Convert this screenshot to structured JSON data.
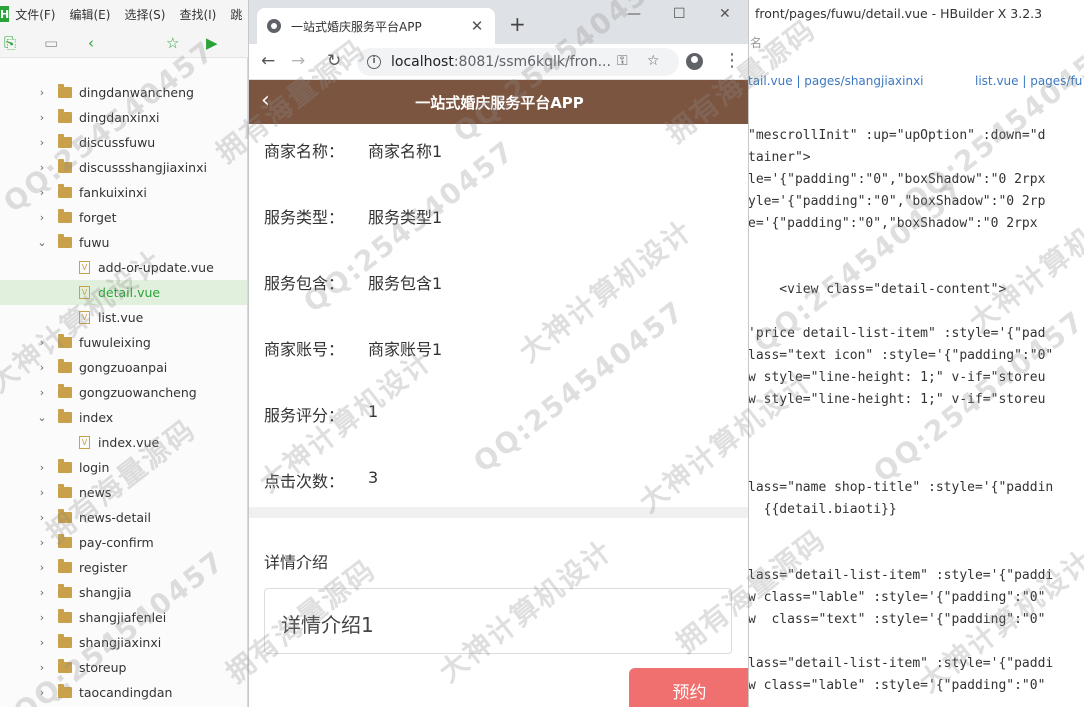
{
  "ide": {
    "logo": "H",
    "menu": [
      "文件(F)",
      "编辑(E)",
      "选择(S)",
      "查找(I)",
      "跳"
    ],
    "title": "front/pages/fuwu/detail.vue - HBuilder X 3.2.3",
    "toolbar_partial": "名",
    "tabs": [
      "tail.vue | pages/shangjiaxinxi",
      "list.vue | pages/fu"
    ],
    "tree": [
      {
        "label": "dingdanwancheng",
        "type": "folder",
        "open": false
      },
      {
        "label": "dingdanxinxi",
        "type": "folder",
        "open": false
      },
      {
        "label": "discussfuwu",
        "type": "folder",
        "open": false
      },
      {
        "label": "discussshangjiaxinxi",
        "type": "folder",
        "open": false
      },
      {
        "label": "fankuixinxi",
        "type": "folder",
        "open": false
      },
      {
        "label": "forget",
        "type": "folder",
        "open": false
      },
      {
        "label": "fuwu",
        "type": "folder",
        "open": true
      },
      {
        "label": "add-or-update.vue",
        "type": "file"
      },
      {
        "label": "detail.vue",
        "type": "file",
        "active": true
      },
      {
        "label": "list.vue",
        "type": "file"
      },
      {
        "label": "fuwuleixing",
        "type": "folder",
        "open": false
      },
      {
        "label": "gongzuoanpai",
        "type": "folder",
        "open": false
      },
      {
        "label": "gongzuowancheng",
        "type": "folder",
        "open": false
      },
      {
        "label": "index",
        "type": "folder",
        "open": true
      },
      {
        "label": "index.vue",
        "type": "file"
      },
      {
        "label": "login",
        "type": "folder",
        "open": false
      },
      {
        "label": "news",
        "type": "folder",
        "open": false
      },
      {
        "label": "news-detail",
        "type": "folder",
        "open": false
      },
      {
        "label": "pay-confirm",
        "type": "folder",
        "open": false
      },
      {
        "label": "register",
        "type": "folder",
        "open": false
      },
      {
        "label": "shangjia",
        "type": "folder",
        "open": false
      },
      {
        "label": "shangjiafenlei",
        "type": "folder",
        "open": false
      },
      {
        "label": "shangjiaxinxi",
        "type": "folder",
        "open": false
      },
      {
        "label": "storeup",
        "type": "folder",
        "open": false
      },
      {
        "label": "taocandingdan",
        "type": "folder",
        "open": false
      }
    ],
    "code": [
      "\"mescrollInit\" :up=\"upOption\" :down=\"d",
      "tainer\">",
      "le='{\"padding\":\"0\",\"boxShadow\":\"0 2rpx",
      "yle='{\"padding\":\"0\",\"boxShadow\":\"0 2rp",
      "e='{\"padding\":\"0\",\"boxShadow\":\"0 2rpx",
      "",
      "",
      "    <view class=\"detail-content\">",
      "",
      "'price detail-list-item\" :style='{\"pad",
      "lass=\"text icon\" :style='{\"padding\":\"0\"",
      "w style=\"line-height: 1;\" v-if=\"storeu",
      "w style=\"line-height: 1;\" v-if=\"storeu",
      "",
      "",
      "",
      "lass=\"name shop-title\" :style='{\"paddin",
      "  {{detail.biaoti}}",
      "",
      "",
      "lass=\"detail-list-item\" :style='{\"paddi",
      "w class=\"lable\" :style='{\"padding\":\"0\"",
      "w  class=\"text\" :style='{\"padding\":\"0\"",
      "",
      "lass=\"detail-list-item\" :style='{\"paddi",
      "w class=\"lable\" :style='{\"padding\":\"0\""
    ]
  },
  "browser": {
    "tab_title": "一站式婚庆服务平台APP",
    "url_host": "localhost",
    "url_rest": ":8081/ssm6kqlk/fron...",
    "new_tab": "+",
    "minimize": "—",
    "maximize": "☐",
    "close": "✕",
    "tab_close": "✕"
  },
  "app": {
    "title": "一站式婚庆服务平台APP",
    "fields": [
      {
        "label": "商家名称：",
        "value": "商家名称1"
      },
      {
        "label": "服务类型：",
        "value": "服务类型1"
      },
      {
        "label": "服务包含：",
        "value": "服务包含1"
      },
      {
        "label": "商家账号：",
        "value": "商家账号1"
      },
      {
        "label": "服务评分：",
        "value": "1"
      },
      {
        "label": "点击次数：",
        "value": "3"
      }
    ],
    "desc_title": "详情介绍",
    "desc_content": "详情介绍1",
    "reserve_label": "预约"
  },
  "watermarks": [
    "QQ:254540457",
    "大神计算机设计",
    "拥有海量源码"
  ]
}
